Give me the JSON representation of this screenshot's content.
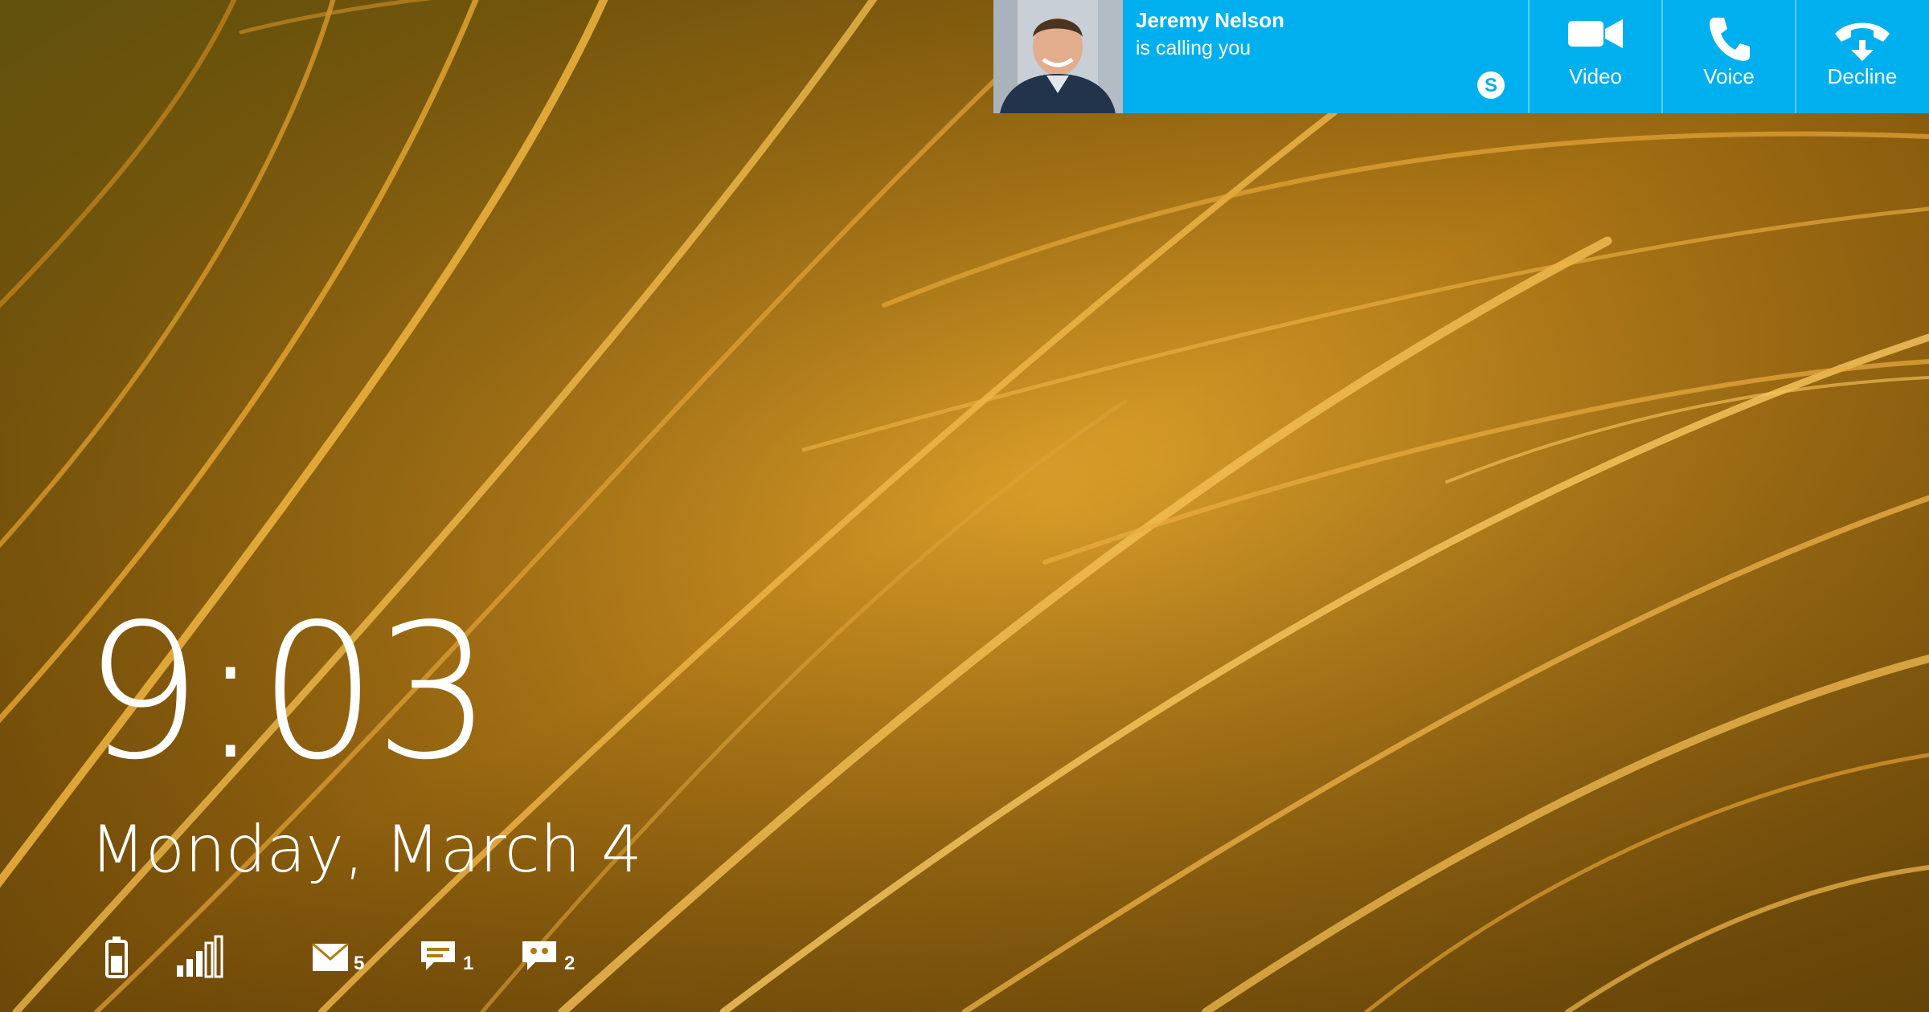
{
  "lock_screen": {
    "time": "9:03",
    "date": "Monday, March 4",
    "status": {
      "battery_icon": "battery-icon",
      "signal_icon": "signal-bars-icon",
      "mail": {
        "icon": "mail-icon",
        "count": "5"
      },
      "messaging": {
        "icon": "message-icon",
        "count": "1"
      },
      "chat": {
        "icon": "chat-icon",
        "count": "2"
      }
    }
  },
  "toast": {
    "app": "Skype",
    "caller_name": "Jeremy Nelson",
    "caller_status": "is calling you",
    "actions": [
      {
        "label": "Video",
        "icon": "video-camera-icon"
      },
      {
        "label": "Voice",
        "icon": "phone-icon"
      },
      {
        "label": "Decline",
        "icon": "hang-up-icon"
      }
    ],
    "accent_color": "#00b0ee"
  }
}
